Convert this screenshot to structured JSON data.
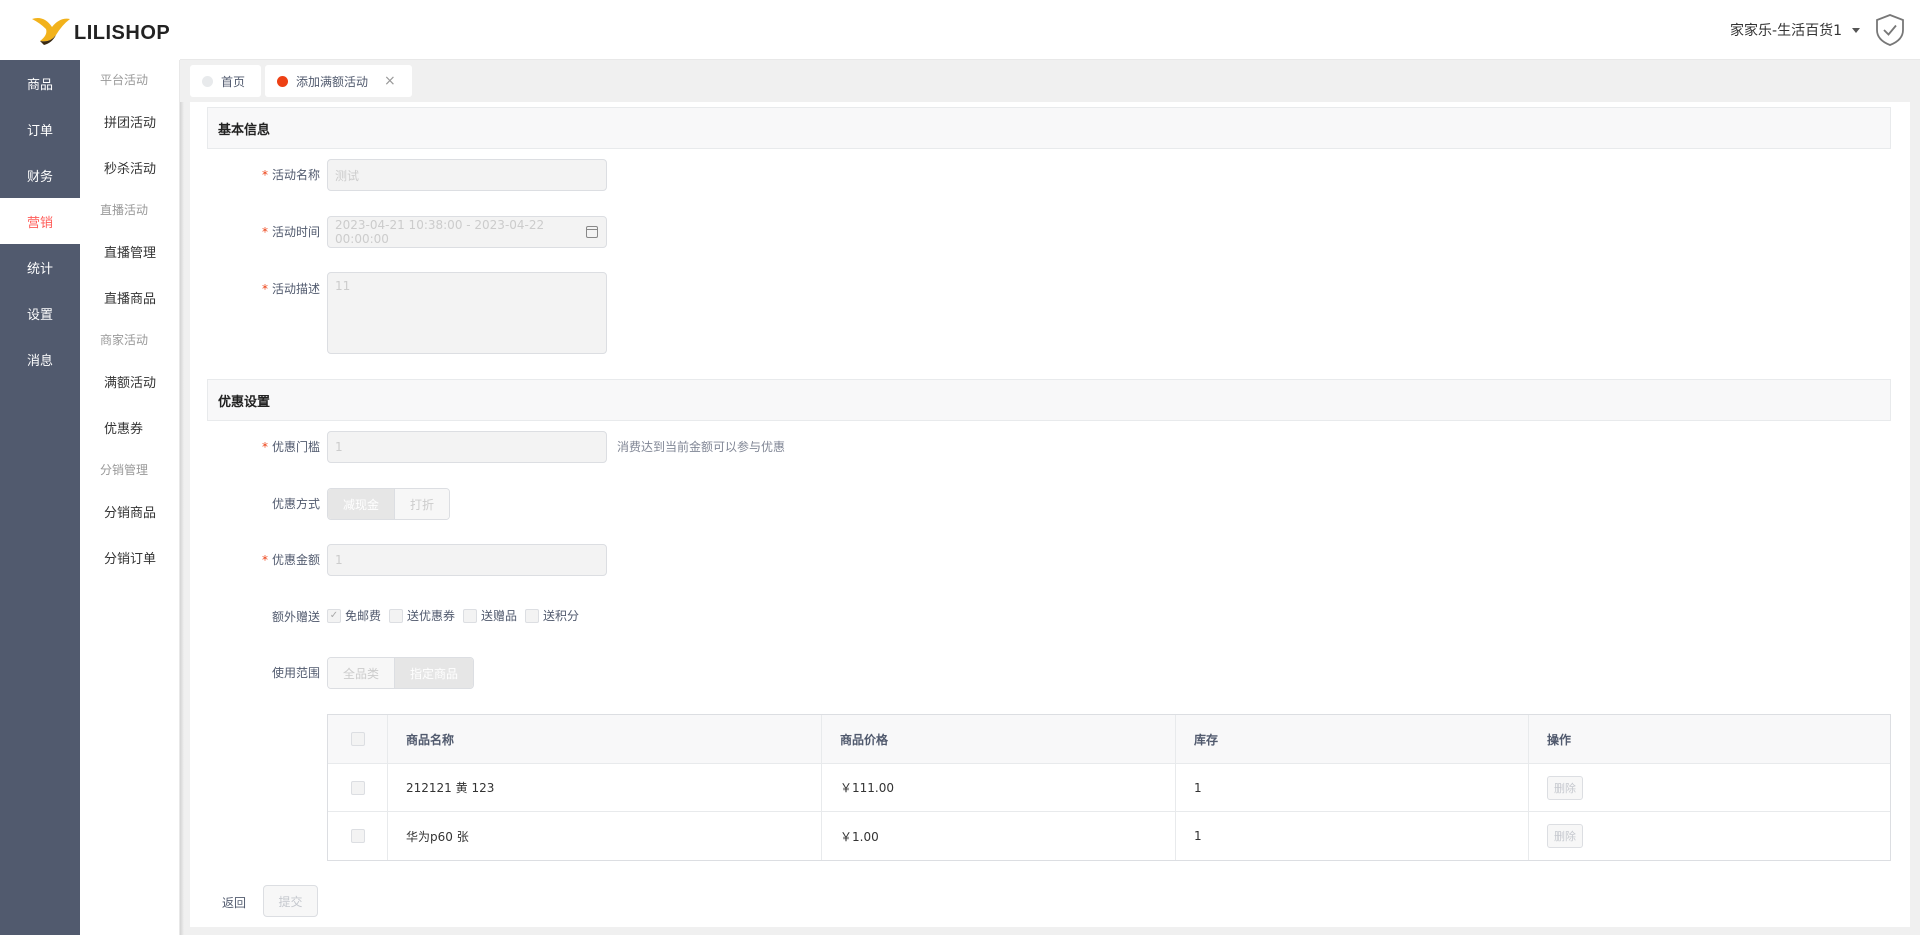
{
  "brand": {
    "name": "LILISHOP"
  },
  "nav_primary": [
    {
      "label": "商品"
    },
    {
      "label": "订单"
    },
    {
      "label": "财务"
    },
    {
      "label": "营销",
      "active": true
    },
    {
      "label": "统计"
    },
    {
      "label": "设置"
    },
    {
      "label": "消息"
    }
  ],
  "nav_secondary": [
    {
      "type": "group",
      "label": "平台活动"
    },
    {
      "type": "item",
      "label": "拼团活动"
    },
    {
      "type": "item",
      "label": "秒杀活动"
    },
    {
      "type": "group",
      "label": "直播活动"
    },
    {
      "type": "item",
      "label": "直播管理"
    },
    {
      "type": "item",
      "label": "直播商品"
    },
    {
      "type": "group",
      "label": "商家活动"
    },
    {
      "type": "item",
      "label": "满额活动"
    },
    {
      "type": "item",
      "label": "优惠券"
    },
    {
      "type": "group",
      "label": "分销管理"
    },
    {
      "type": "item",
      "label": "分销商品"
    },
    {
      "type": "item",
      "label": "分销订单"
    }
  ],
  "header": {
    "store_name": "家家乐-生活百货1"
  },
  "tabs": [
    {
      "label": "首页",
      "active": false
    },
    {
      "label": "添加满额活动",
      "active": true
    }
  ],
  "basic_info": {
    "title": "基本信息",
    "name_label": "活动名称",
    "name_value": "测试",
    "time_label": "活动时间",
    "time_value": "2023-04-21 10:38:00 - 2023-04-22 00:00:00",
    "desc_label": "活动描述",
    "desc_value": "11"
  },
  "discount": {
    "title": "优惠设置",
    "threshold_label": "优惠门槛",
    "threshold_value": "1",
    "threshold_hint": "消费达到当前金额可以参与优惠",
    "method_label": "优惠方式",
    "method_options": [
      "减现金",
      "打折"
    ],
    "method_selected": "减现金",
    "amount_label": "优惠金额",
    "amount_value": "1",
    "extra_label": "额外赠送",
    "extras": [
      {
        "label": "免邮费",
        "checked": true
      },
      {
        "label": "送优惠券",
        "checked": false
      },
      {
        "label": "送赠品",
        "checked": false
      },
      {
        "label": "送积分",
        "checked": false
      }
    ],
    "scope_label": "使用范围",
    "scope_options": [
      "全品类",
      "指定商品"
    ],
    "scope_selected": "指定商品"
  },
  "goods_table": {
    "columns": [
      "商品名称",
      "商品价格",
      "库存",
      "操作"
    ],
    "rows": [
      {
        "name": "212121 黄 123",
        "price": "￥111.00",
        "stock": "1",
        "action": "删除"
      },
      {
        "name": "华为p60 张",
        "price": "￥1.00",
        "stock": "1",
        "action": "删除"
      }
    ]
  },
  "footer": {
    "back_label": "返回",
    "submit_label": "提交"
  },
  "colors": {
    "nav_bg": "#515a6e",
    "accent": "#ff5c58",
    "required": "#ed4014"
  }
}
